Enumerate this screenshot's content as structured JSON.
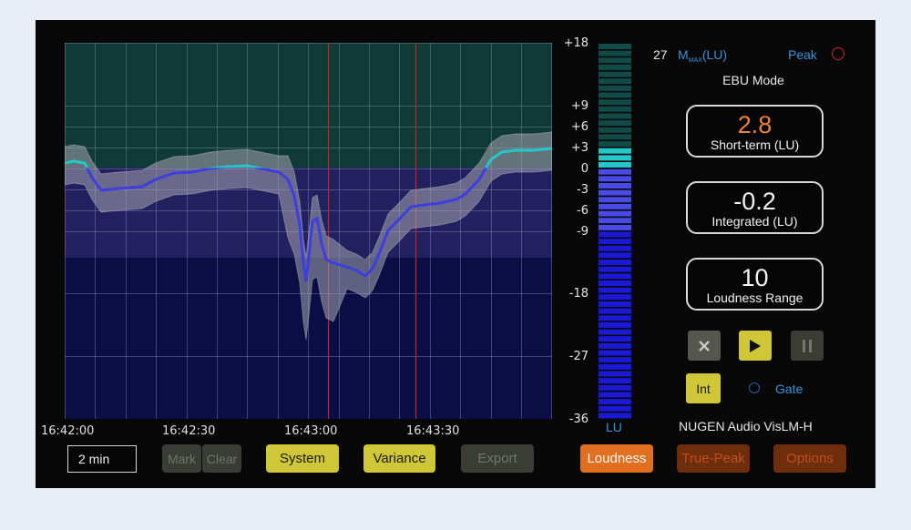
{
  "app": {
    "brand": "NUGEN Audio VisLM-H",
    "mode": "EBU Mode"
  },
  "colors": {
    "accent_yellow": "#cfc737",
    "accent_blue": "#3a92d8",
    "short_term_orange": "#e98237",
    "meter_cyan": "#24c8c8",
    "meter_blue": "#3d3de0",
    "peak_red": "#c0282a"
  },
  "scale": {
    "top": "+18",
    "bottom": "-36",
    "ticks": [
      "+18",
      "+9",
      "+6",
      "+3",
      "0",
      "-3",
      "-6",
      "-9",
      "-18",
      "-27",
      "-36"
    ],
    "unit": "LU"
  },
  "time_axis": [
    "16:42:00",
    "16:42:30",
    "16:43:00",
    "16:43:30"
  ],
  "meter": {
    "level_lu": 2.8
  },
  "header": {
    "mmax_value": "27",
    "mmax_label_main": "M",
    "mmax_label_sub": "MAX",
    "mmax_label_tail": "(LU)",
    "peak_label": "Peak"
  },
  "readouts": {
    "short_term": {
      "value": "2.8",
      "caption": "Short-term (LU)"
    },
    "integrated": {
      "value": "-0.2",
      "caption": "Integrated (LU)"
    },
    "range": {
      "value": "10",
      "caption": "Loudness Range"
    }
  },
  "transport": {
    "reset_icon": "close-icon",
    "play_icon": "play-icon",
    "pause_icon": "pause-icon"
  },
  "gate": {
    "int_label": "Int",
    "gate_label": "Gate"
  },
  "controls": {
    "timespan": "2 min",
    "mark": "Mark",
    "clear": "Clear",
    "system": "System",
    "variance": "Variance",
    "export": "Export",
    "loudness": "Loudness",
    "true_peak": "True-Peak",
    "options": "Options"
  }
}
